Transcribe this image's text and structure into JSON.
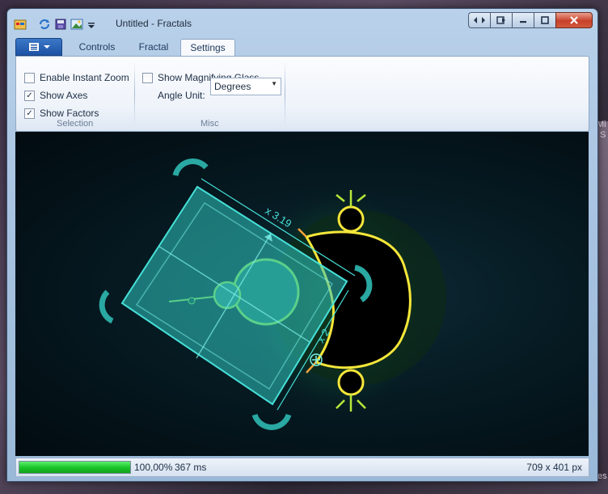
{
  "window": {
    "title": "Untitled - Fractals",
    "caption_buttons": [
      "switch-panes-icon",
      "dock-icon",
      "minimize-icon",
      "maximize-icon",
      "close-icon"
    ]
  },
  "quick_access": [
    "app-icon",
    "refresh-icon",
    "save-icon",
    "image-icon",
    "dropdown-icon"
  ],
  "tabs": [
    {
      "label": "Controls",
      "active": false
    },
    {
      "label": "Fractal",
      "active": false
    },
    {
      "label": "Settings",
      "active": true
    }
  ],
  "ribbon": {
    "selection_group": {
      "label": "Selection",
      "options": [
        {
          "label": "Enable Instant Zoom",
          "checked": false
        },
        {
          "label": "Show Axes",
          "checked": true
        },
        {
          "label": "Show Factors",
          "checked": true
        }
      ]
    },
    "misc_group": {
      "label": "Misc",
      "magnifier": {
        "label": "Show Magnifying Glass",
        "checked": false
      },
      "angle_unit": {
        "label": "Angle Unit:",
        "value": "Degrees"
      }
    }
  },
  "selection_overlay": {
    "factor_x": "x 3.19",
    "factor_y": "x 2"
  },
  "status": {
    "progress": 1.0,
    "percent": "100,00%",
    "time": "367 ms",
    "size": "709 x 401 px"
  },
  "colors": {
    "accent": "#1d52a4",
    "progress": "#1cc72a",
    "selection": "#2fc7c0",
    "fractal_edge": "#f5e63a"
  },
  "desktop": {
    "right_labels": [
      "Mi",
      "S",
      "es"
    ]
  }
}
